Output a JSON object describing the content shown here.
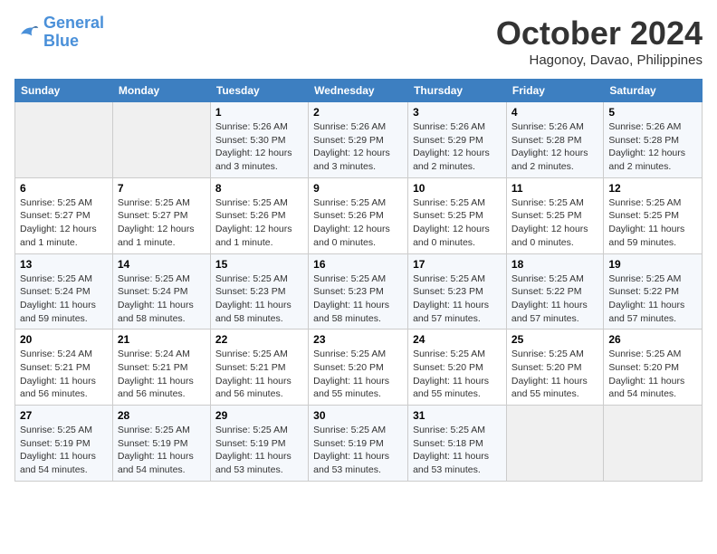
{
  "header": {
    "logo_line1": "General",
    "logo_line2": "Blue",
    "month_title": "October 2024",
    "location": "Hagonoy, Davao, Philippines"
  },
  "weekdays": [
    "Sunday",
    "Monday",
    "Tuesday",
    "Wednesday",
    "Thursday",
    "Friday",
    "Saturday"
  ],
  "weeks": [
    [
      {
        "day": "",
        "info": ""
      },
      {
        "day": "",
        "info": ""
      },
      {
        "day": "1",
        "info": "Sunrise: 5:26 AM\nSunset: 5:30 PM\nDaylight: 12 hours and 3 minutes."
      },
      {
        "day": "2",
        "info": "Sunrise: 5:26 AM\nSunset: 5:29 PM\nDaylight: 12 hours and 3 minutes."
      },
      {
        "day": "3",
        "info": "Sunrise: 5:26 AM\nSunset: 5:29 PM\nDaylight: 12 hours and 2 minutes."
      },
      {
        "day": "4",
        "info": "Sunrise: 5:26 AM\nSunset: 5:28 PM\nDaylight: 12 hours and 2 minutes."
      },
      {
        "day": "5",
        "info": "Sunrise: 5:26 AM\nSunset: 5:28 PM\nDaylight: 12 hours and 2 minutes."
      }
    ],
    [
      {
        "day": "6",
        "info": "Sunrise: 5:25 AM\nSunset: 5:27 PM\nDaylight: 12 hours and 1 minute."
      },
      {
        "day": "7",
        "info": "Sunrise: 5:25 AM\nSunset: 5:27 PM\nDaylight: 12 hours and 1 minute."
      },
      {
        "day": "8",
        "info": "Sunrise: 5:25 AM\nSunset: 5:26 PM\nDaylight: 12 hours and 1 minute."
      },
      {
        "day": "9",
        "info": "Sunrise: 5:25 AM\nSunset: 5:26 PM\nDaylight: 12 hours and 0 minutes."
      },
      {
        "day": "10",
        "info": "Sunrise: 5:25 AM\nSunset: 5:25 PM\nDaylight: 12 hours and 0 minutes."
      },
      {
        "day": "11",
        "info": "Sunrise: 5:25 AM\nSunset: 5:25 PM\nDaylight: 12 hours and 0 minutes."
      },
      {
        "day": "12",
        "info": "Sunrise: 5:25 AM\nSunset: 5:25 PM\nDaylight: 11 hours and 59 minutes."
      }
    ],
    [
      {
        "day": "13",
        "info": "Sunrise: 5:25 AM\nSunset: 5:24 PM\nDaylight: 11 hours and 59 minutes."
      },
      {
        "day": "14",
        "info": "Sunrise: 5:25 AM\nSunset: 5:24 PM\nDaylight: 11 hours and 58 minutes."
      },
      {
        "day": "15",
        "info": "Sunrise: 5:25 AM\nSunset: 5:23 PM\nDaylight: 11 hours and 58 minutes."
      },
      {
        "day": "16",
        "info": "Sunrise: 5:25 AM\nSunset: 5:23 PM\nDaylight: 11 hours and 58 minutes."
      },
      {
        "day": "17",
        "info": "Sunrise: 5:25 AM\nSunset: 5:23 PM\nDaylight: 11 hours and 57 minutes."
      },
      {
        "day": "18",
        "info": "Sunrise: 5:25 AM\nSunset: 5:22 PM\nDaylight: 11 hours and 57 minutes."
      },
      {
        "day": "19",
        "info": "Sunrise: 5:25 AM\nSunset: 5:22 PM\nDaylight: 11 hours and 57 minutes."
      }
    ],
    [
      {
        "day": "20",
        "info": "Sunrise: 5:24 AM\nSunset: 5:21 PM\nDaylight: 11 hours and 56 minutes."
      },
      {
        "day": "21",
        "info": "Sunrise: 5:24 AM\nSunset: 5:21 PM\nDaylight: 11 hours and 56 minutes."
      },
      {
        "day": "22",
        "info": "Sunrise: 5:25 AM\nSunset: 5:21 PM\nDaylight: 11 hours and 56 minutes."
      },
      {
        "day": "23",
        "info": "Sunrise: 5:25 AM\nSunset: 5:20 PM\nDaylight: 11 hours and 55 minutes."
      },
      {
        "day": "24",
        "info": "Sunrise: 5:25 AM\nSunset: 5:20 PM\nDaylight: 11 hours and 55 minutes."
      },
      {
        "day": "25",
        "info": "Sunrise: 5:25 AM\nSunset: 5:20 PM\nDaylight: 11 hours and 55 minutes."
      },
      {
        "day": "26",
        "info": "Sunrise: 5:25 AM\nSunset: 5:20 PM\nDaylight: 11 hours and 54 minutes."
      }
    ],
    [
      {
        "day": "27",
        "info": "Sunrise: 5:25 AM\nSunset: 5:19 PM\nDaylight: 11 hours and 54 minutes."
      },
      {
        "day": "28",
        "info": "Sunrise: 5:25 AM\nSunset: 5:19 PM\nDaylight: 11 hours and 54 minutes."
      },
      {
        "day": "29",
        "info": "Sunrise: 5:25 AM\nSunset: 5:19 PM\nDaylight: 11 hours and 53 minutes."
      },
      {
        "day": "30",
        "info": "Sunrise: 5:25 AM\nSunset: 5:19 PM\nDaylight: 11 hours and 53 minutes."
      },
      {
        "day": "31",
        "info": "Sunrise: 5:25 AM\nSunset: 5:18 PM\nDaylight: 11 hours and 53 minutes."
      },
      {
        "day": "",
        "info": ""
      },
      {
        "day": "",
        "info": ""
      }
    ]
  ]
}
